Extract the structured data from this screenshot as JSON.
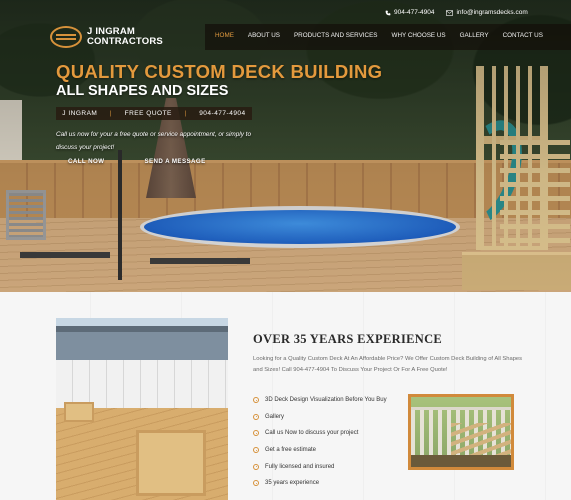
{
  "contact": {
    "phone": "904-477-4904",
    "email": "info@ingramsdecks.com",
    "phone_icon": "phone-icon",
    "email_icon": "envelope-icon"
  },
  "brand": {
    "name_line1": "J INGRAM",
    "name_line2": "CONTRACTORS",
    "accent_color": "#d6923b"
  },
  "nav": {
    "items": [
      {
        "label": "HOME",
        "active": true
      },
      {
        "label": "ABOUT US"
      },
      {
        "label": "PRODUCTS AND SERVICES"
      },
      {
        "label": "WHY CHOOSE US"
      },
      {
        "label": "GALLERY"
      },
      {
        "label": "CONTACT US"
      }
    ]
  },
  "hero": {
    "headline": "QUALITY CUSTOM DECK BUILDING",
    "subheadline": "ALL SHAPES AND SIZES",
    "strip": {
      "name": "J INGRAM",
      "offer": "FREE QUOTE",
      "phone": "904-477-4904",
      "separator": "|"
    },
    "intro": "Call us now for your a free quote or service appointment, or simply to discuss your project!",
    "cta_call": "CALL NOW",
    "cta_message": "SEND A MESSAGE"
  },
  "about": {
    "title": "OVER 35 YEARS EXPERIENCE",
    "description": "Looking for a Quality Custom Deck At An Affordable Price? We Offer Custom Deck Building of All Shapes and Sizes! Call 904-477-4904 To Discuss Your Project Or For A Free Quote!",
    "features": [
      "3D Deck Design Visualization Before You Buy",
      "Gallery",
      "Call us Now to discuss your project",
      "Get a free estimate",
      "Fully licensed and insured",
      "35 years experience"
    ]
  }
}
